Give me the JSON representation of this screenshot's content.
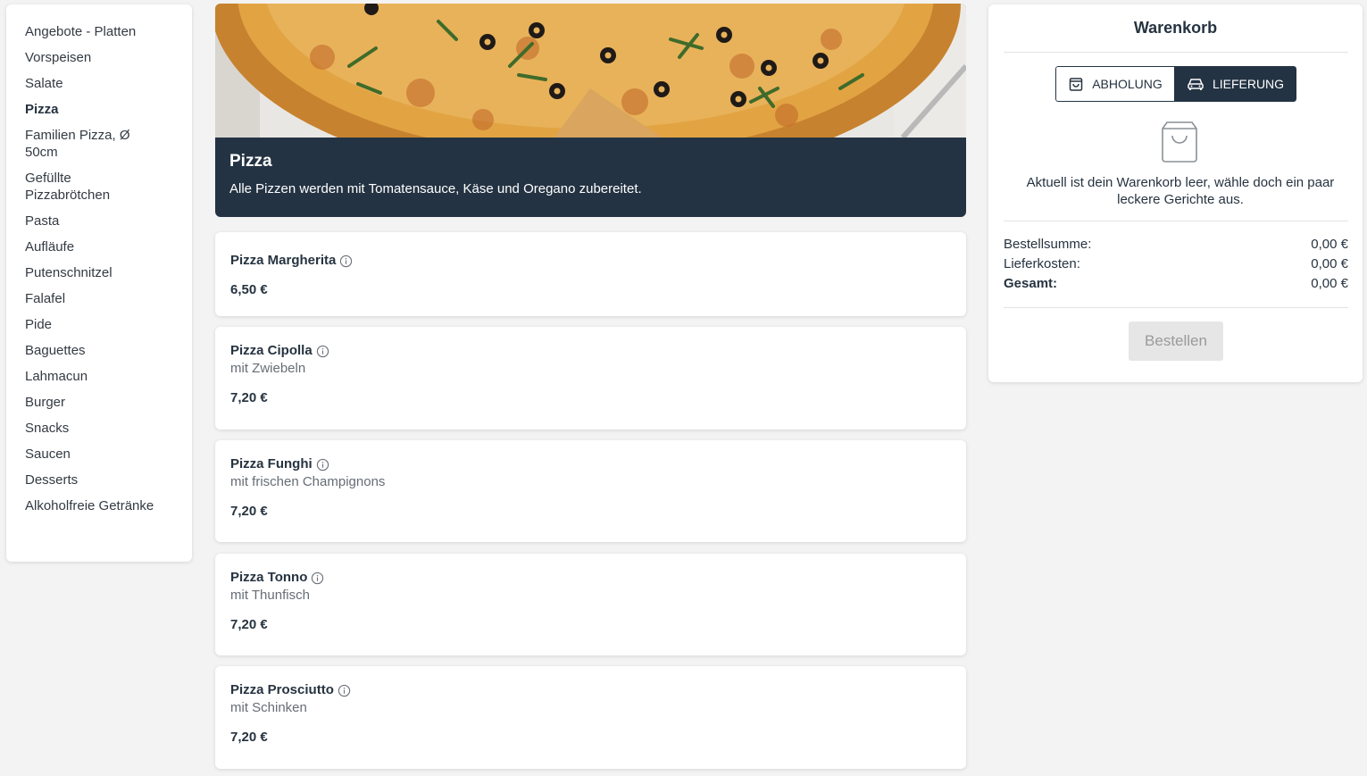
{
  "sidebar": {
    "items": [
      {
        "label": "Angebote - Platten",
        "active": false
      },
      {
        "label": "Vorspeisen",
        "active": false
      },
      {
        "label": "Salate",
        "active": false
      },
      {
        "label": "Pizza",
        "active": true
      },
      {
        "label": "Familien Pizza, Ø 50cm",
        "active": false
      },
      {
        "label": "Gefüllte Pizzabrötchen",
        "active": false
      },
      {
        "label": "Pasta",
        "active": false
      },
      {
        "label": "Aufläufe",
        "active": false
      },
      {
        "label": "Putenschnitzel",
        "active": false
      },
      {
        "label": "Falafel",
        "active": false
      },
      {
        "label": "Pide",
        "active": false
      },
      {
        "label": "Baguettes",
        "active": false
      },
      {
        "label": "Lahmacun",
        "active": false
      },
      {
        "label": "Burger",
        "active": false
      },
      {
        "label": "Snacks",
        "active": false
      },
      {
        "label": "Saucen",
        "active": false
      },
      {
        "label": "Desserts",
        "active": false
      },
      {
        "label": "Alkoholfreie Getränke",
        "active": false
      }
    ]
  },
  "category": {
    "title": "Pizza",
    "description": "Alle Pizzen werden mit Tomatensauce, Käse und Oregano zubereitet.",
    "image_icon": "pizza-photo"
  },
  "products": [
    {
      "name": "Pizza Margherita",
      "description": "",
      "price": "6,50 €"
    },
    {
      "name": "Pizza Cipolla",
      "description": "mit Zwiebeln",
      "price": "7,20 €"
    },
    {
      "name": "Pizza Funghi",
      "description": "mit frischen Champignons",
      "price": "7,20 €"
    },
    {
      "name": "Pizza Tonno",
      "description": "mit Thunfisch",
      "price": "7,20 €"
    },
    {
      "name": "Pizza Prosciutto",
      "description": "mit Schinken",
      "price": "7,20 €"
    }
  ],
  "cart": {
    "title": "Warenkorb",
    "pickup_label": "ABHOLUNG",
    "delivery_label": "LIEFERUNG",
    "selected_mode": "delivery",
    "empty_text": "Aktuell ist dein Warenkorb leer, wähle doch ein paar leckere Gerichte aus.",
    "subtotal_label": "Bestellsumme:",
    "subtotal_value": "0,00 €",
    "delivery_cost_label": "Lieferkosten:",
    "delivery_cost_value": "0,00 €",
    "total_label": "Gesamt:",
    "total_value": "0,00 €",
    "order_button": "Bestellen",
    "order_button_enabled": false
  },
  "colors": {
    "accent_dark": "#243343",
    "background": "#f3f3f3"
  }
}
